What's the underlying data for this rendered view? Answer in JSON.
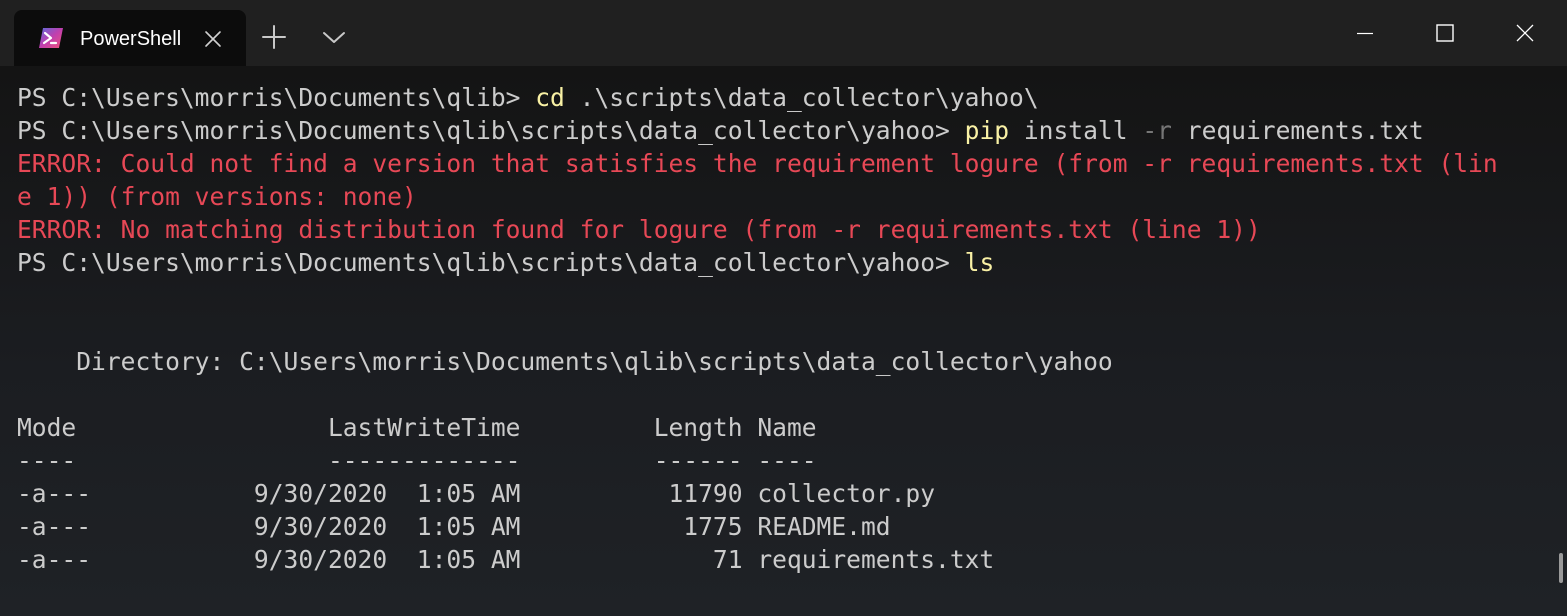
{
  "window": {
    "tab_title": "PowerShell",
    "icons": {
      "tab": "powershell-icon",
      "tab_close": "close-icon",
      "new_tab": "plus-icon",
      "dropdown": "chevron-down-icon",
      "minimize": "minimize-icon",
      "maximize": "maximize-icon",
      "close": "close-icon"
    }
  },
  "colors": {
    "titlebar": "#202020",
    "terminal_bg": "#0c0c0c",
    "default_text": "#cccccc",
    "command": "#f9f1a5",
    "parameter": "#767676",
    "error": "#e74856"
  },
  "terminal": {
    "lines": [
      [
        {
          "text": "PS C:\\Users\\morris\\Documents\\qlib> ",
          "style": "default"
        },
        {
          "text": "cd",
          "style": "cmd"
        },
        {
          "text": " .\\scripts\\data_collector\\yahoo\\",
          "style": "default"
        }
      ],
      [
        {
          "text": "PS C:\\Users\\morris\\Documents\\qlib\\scripts\\data_collector\\yahoo> ",
          "style": "default"
        },
        {
          "text": "pip",
          "style": "cmd"
        },
        {
          "text": " install ",
          "style": "default"
        },
        {
          "text": "-r",
          "style": "param"
        },
        {
          "text": " requirements.txt",
          "style": "default"
        }
      ],
      [
        {
          "text": "ERROR: Could not find a version that satisfies the requirement logure (from -r requirements.txt (lin",
          "style": "error"
        }
      ],
      [
        {
          "text": "e 1)) (from versions: none)",
          "style": "error"
        }
      ],
      [
        {
          "text": "ERROR: No matching distribution found for logure (from -r requirements.txt (line 1))",
          "style": "error"
        }
      ],
      [
        {
          "text": "PS C:\\Users\\morris\\Documents\\qlib\\scripts\\data_collector\\yahoo> ",
          "style": "default"
        },
        {
          "text": "ls",
          "style": "cmd"
        }
      ],
      [],
      [],
      [
        {
          "text": "    Directory: C:\\Users\\morris\\Documents\\qlib\\scripts\\data_collector\\yahoo",
          "style": "default"
        }
      ],
      [],
      [
        {
          "text": "Mode                 LastWriteTime         Length Name",
          "style": "default"
        }
      ],
      [
        {
          "text": "----                 -------------         ------ ----",
          "style": "default"
        }
      ],
      [
        {
          "text": "-a---           9/30/2020  1:05 AM          11790 collector.py",
          "style": "default"
        }
      ],
      [
        {
          "text": "-a---           9/30/2020  1:05 AM           1775 README.md",
          "style": "default"
        }
      ],
      [
        {
          "text": "-a---           9/30/2020  1:05 AM             71 requirements.txt",
          "style": "default"
        }
      ]
    ]
  }
}
